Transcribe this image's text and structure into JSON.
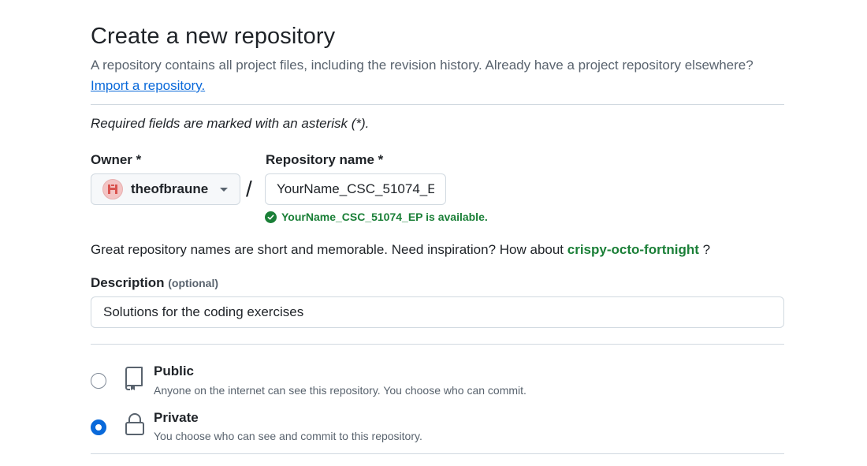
{
  "header": {
    "title": "Create a new repository",
    "subtitle": "A repository contains all project files, including the revision history. Already have a project repository elsewhere?",
    "import_link": "Import a repository."
  },
  "form": {
    "required_note": "Required fields are marked with an asterisk (*).",
    "owner": {
      "label": "Owner *",
      "value": "theofbraune"
    },
    "separator": "/",
    "repo_name": {
      "label": "Repository name *",
      "value": "YourName_CSC_51074_EP",
      "availability": "YourName_CSC_51074_EP is available."
    },
    "inspiration": {
      "text": "Great repository names are short and memorable. Need inspiration? How about",
      "suggestion": "crispy-octo-fortnight",
      "suffix": "?"
    },
    "description": {
      "label": "Description",
      "optional": "(optional)",
      "value": "Solutions for the coding exercises"
    },
    "visibility": [
      {
        "title": "Public",
        "description": "Anyone on the internet can see this repository. You choose who can commit.",
        "selected": false,
        "icon": "repo-icon"
      },
      {
        "title": "Private",
        "description": "You choose who can see and commit to this repository.",
        "selected": true,
        "icon": "lock-icon"
      }
    ]
  },
  "colors": {
    "accent": "#0969da",
    "success": "#1a7f37",
    "muted": "#59636e",
    "border": "#d1d9e0"
  }
}
